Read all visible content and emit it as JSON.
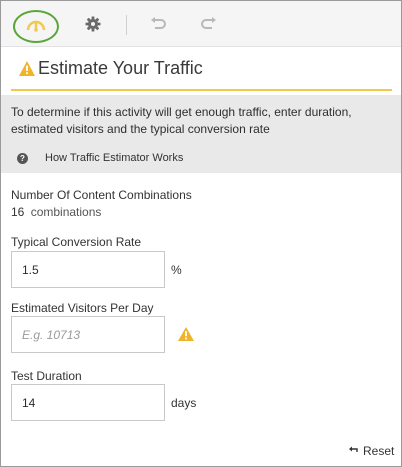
{
  "toolbar": {
    "icons": [
      "gauge-icon",
      "gear-icon",
      "undo-icon",
      "redo-icon"
    ],
    "highlight_color": "#5aa63a"
  },
  "header": {
    "title": "Estimate Your Traffic",
    "accent_color": "#f2c94c"
  },
  "info": {
    "description": "To determine if this activity will get enough traffic, enter duration, estimated visitors and the typical conversion rate",
    "help_link": "How Traffic Estimator Works"
  },
  "form": {
    "combinations": {
      "label": "Number Of Content Combinations",
      "value": "16",
      "unit": "combinations"
    },
    "conversion_rate": {
      "label": "Typical Conversion Rate",
      "value": "1.5",
      "unit": "%"
    },
    "visitors": {
      "label": "Estimated Visitors Per Day",
      "value": "",
      "placeholder": "E.g. 10713"
    },
    "duration": {
      "label": "Test Duration",
      "value": "14",
      "unit": "days"
    }
  },
  "footer": {
    "reset_label": "Reset"
  }
}
